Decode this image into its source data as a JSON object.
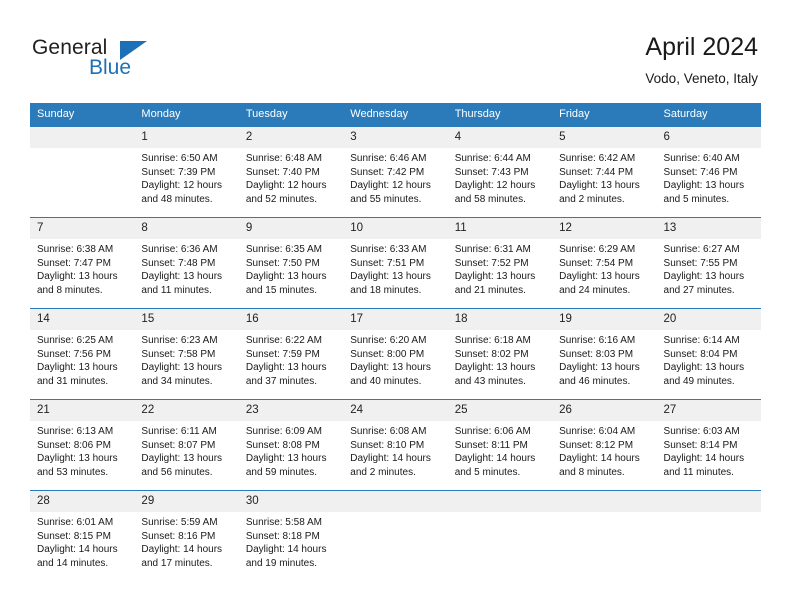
{
  "logo": {
    "text_primary": "General",
    "text_secondary": "Blue",
    "triangle_color": "#1d70b8",
    "primary_color": "#231f20"
  },
  "header": {
    "title": "April 2024",
    "subtitle": "Vodo, Veneto, Italy"
  },
  "theme": {
    "header_row_bg": "#2b7bba",
    "header_row_text": "#ffffff",
    "daynum_bg": "#f0f0f0",
    "row_rule": "#2b7bba"
  },
  "weekday_headers": [
    "Sunday",
    "Monday",
    "Tuesday",
    "Wednesday",
    "Thursday",
    "Friday",
    "Saturday"
  ],
  "weeks": [
    [
      {
        "day": "",
        "empty": true,
        "sunrise": "",
        "sunset": "",
        "daylight_line1": "",
        "daylight_line2": ""
      },
      {
        "day": "1",
        "empty": false,
        "sunrise": "Sunrise: 6:50 AM",
        "sunset": "Sunset: 7:39 PM",
        "daylight_line1": "Daylight: 12 hours",
        "daylight_line2": "and 48 minutes."
      },
      {
        "day": "2",
        "empty": false,
        "sunrise": "Sunrise: 6:48 AM",
        "sunset": "Sunset: 7:40 PM",
        "daylight_line1": "Daylight: 12 hours",
        "daylight_line2": "and 52 minutes."
      },
      {
        "day": "3",
        "empty": false,
        "sunrise": "Sunrise: 6:46 AM",
        "sunset": "Sunset: 7:42 PM",
        "daylight_line1": "Daylight: 12 hours",
        "daylight_line2": "and 55 minutes."
      },
      {
        "day": "4",
        "empty": false,
        "sunrise": "Sunrise: 6:44 AM",
        "sunset": "Sunset: 7:43 PM",
        "daylight_line1": "Daylight: 12 hours",
        "daylight_line2": "and 58 minutes."
      },
      {
        "day": "5",
        "empty": false,
        "sunrise": "Sunrise: 6:42 AM",
        "sunset": "Sunset: 7:44 PM",
        "daylight_line1": "Daylight: 13 hours",
        "daylight_line2": "and 2 minutes."
      },
      {
        "day": "6",
        "empty": false,
        "sunrise": "Sunrise: 6:40 AM",
        "sunset": "Sunset: 7:46 PM",
        "daylight_line1": "Daylight: 13 hours",
        "daylight_line2": "and 5 minutes."
      }
    ],
    [
      {
        "day": "7",
        "empty": false,
        "sunrise": "Sunrise: 6:38 AM",
        "sunset": "Sunset: 7:47 PM",
        "daylight_line1": "Daylight: 13 hours",
        "daylight_line2": "and 8 minutes."
      },
      {
        "day": "8",
        "empty": false,
        "sunrise": "Sunrise: 6:36 AM",
        "sunset": "Sunset: 7:48 PM",
        "daylight_line1": "Daylight: 13 hours",
        "daylight_line2": "and 11 minutes."
      },
      {
        "day": "9",
        "empty": false,
        "sunrise": "Sunrise: 6:35 AM",
        "sunset": "Sunset: 7:50 PM",
        "daylight_line1": "Daylight: 13 hours",
        "daylight_line2": "and 15 minutes."
      },
      {
        "day": "10",
        "empty": false,
        "sunrise": "Sunrise: 6:33 AM",
        "sunset": "Sunset: 7:51 PM",
        "daylight_line1": "Daylight: 13 hours",
        "daylight_line2": "and 18 minutes."
      },
      {
        "day": "11",
        "empty": false,
        "sunrise": "Sunrise: 6:31 AM",
        "sunset": "Sunset: 7:52 PM",
        "daylight_line1": "Daylight: 13 hours",
        "daylight_line2": "and 21 minutes."
      },
      {
        "day": "12",
        "empty": false,
        "sunrise": "Sunrise: 6:29 AM",
        "sunset": "Sunset: 7:54 PM",
        "daylight_line1": "Daylight: 13 hours",
        "daylight_line2": "and 24 minutes."
      },
      {
        "day": "13",
        "empty": false,
        "sunrise": "Sunrise: 6:27 AM",
        "sunset": "Sunset: 7:55 PM",
        "daylight_line1": "Daylight: 13 hours",
        "daylight_line2": "and 27 minutes."
      }
    ],
    [
      {
        "day": "14",
        "empty": false,
        "sunrise": "Sunrise: 6:25 AM",
        "sunset": "Sunset: 7:56 PM",
        "daylight_line1": "Daylight: 13 hours",
        "daylight_line2": "and 31 minutes."
      },
      {
        "day": "15",
        "empty": false,
        "sunrise": "Sunrise: 6:23 AM",
        "sunset": "Sunset: 7:58 PM",
        "daylight_line1": "Daylight: 13 hours",
        "daylight_line2": "and 34 minutes."
      },
      {
        "day": "16",
        "empty": false,
        "sunrise": "Sunrise: 6:22 AM",
        "sunset": "Sunset: 7:59 PM",
        "daylight_line1": "Daylight: 13 hours",
        "daylight_line2": "and 37 minutes."
      },
      {
        "day": "17",
        "empty": false,
        "sunrise": "Sunrise: 6:20 AM",
        "sunset": "Sunset: 8:00 PM",
        "daylight_line1": "Daylight: 13 hours",
        "daylight_line2": "and 40 minutes."
      },
      {
        "day": "18",
        "empty": false,
        "sunrise": "Sunrise: 6:18 AM",
        "sunset": "Sunset: 8:02 PM",
        "daylight_line1": "Daylight: 13 hours",
        "daylight_line2": "and 43 minutes."
      },
      {
        "day": "19",
        "empty": false,
        "sunrise": "Sunrise: 6:16 AM",
        "sunset": "Sunset: 8:03 PM",
        "daylight_line1": "Daylight: 13 hours",
        "daylight_line2": "and 46 minutes."
      },
      {
        "day": "20",
        "empty": false,
        "sunrise": "Sunrise: 6:14 AM",
        "sunset": "Sunset: 8:04 PM",
        "daylight_line1": "Daylight: 13 hours",
        "daylight_line2": "and 49 minutes."
      }
    ],
    [
      {
        "day": "21",
        "empty": false,
        "sunrise": "Sunrise: 6:13 AM",
        "sunset": "Sunset: 8:06 PM",
        "daylight_line1": "Daylight: 13 hours",
        "daylight_line2": "and 53 minutes."
      },
      {
        "day": "22",
        "empty": false,
        "sunrise": "Sunrise: 6:11 AM",
        "sunset": "Sunset: 8:07 PM",
        "daylight_line1": "Daylight: 13 hours",
        "daylight_line2": "and 56 minutes."
      },
      {
        "day": "23",
        "empty": false,
        "sunrise": "Sunrise: 6:09 AM",
        "sunset": "Sunset: 8:08 PM",
        "daylight_line1": "Daylight: 13 hours",
        "daylight_line2": "and 59 minutes."
      },
      {
        "day": "24",
        "empty": false,
        "sunrise": "Sunrise: 6:08 AM",
        "sunset": "Sunset: 8:10 PM",
        "daylight_line1": "Daylight: 14 hours",
        "daylight_line2": "and 2 minutes."
      },
      {
        "day": "25",
        "empty": false,
        "sunrise": "Sunrise: 6:06 AM",
        "sunset": "Sunset: 8:11 PM",
        "daylight_line1": "Daylight: 14 hours",
        "daylight_line2": "and 5 minutes."
      },
      {
        "day": "26",
        "empty": false,
        "sunrise": "Sunrise: 6:04 AM",
        "sunset": "Sunset: 8:12 PM",
        "daylight_line1": "Daylight: 14 hours",
        "daylight_line2": "and 8 minutes."
      },
      {
        "day": "27",
        "empty": false,
        "sunrise": "Sunrise: 6:03 AM",
        "sunset": "Sunset: 8:14 PM",
        "daylight_line1": "Daylight: 14 hours",
        "daylight_line2": "and 11 minutes."
      }
    ],
    [
      {
        "day": "28",
        "empty": false,
        "sunrise": "Sunrise: 6:01 AM",
        "sunset": "Sunset: 8:15 PM",
        "daylight_line1": "Daylight: 14 hours",
        "daylight_line2": "and 14 minutes."
      },
      {
        "day": "29",
        "empty": false,
        "sunrise": "Sunrise: 5:59 AM",
        "sunset": "Sunset: 8:16 PM",
        "daylight_line1": "Daylight: 14 hours",
        "daylight_line2": "and 17 minutes."
      },
      {
        "day": "30",
        "empty": false,
        "sunrise": "Sunrise: 5:58 AM",
        "sunset": "Sunset: 8:18 PM",
        "daylight_line1": "Daylight: 14 hours",
        "daylight_line2": "and 19 minutes."
      },
      {
        "day": "",
        "empty": true,
        "sunrise": "",
        "sunset": "",
        "daylight_line1": "",
        "daylight_line2": ""
      },
      {
        "day": "",
        "empty": true,
        "sunrise": "",
        "sunset": "",
        "daylight_line1": "",
        "daylight_line2": ""
      },
      {
        "day": "",
        "empty": true,
        "sunrise": "",
        "sunset": "",
        "daylight_line1": "",
        "daylight_line2": ""
      },
      {
        "day": "",
        "empty": true,
        "sunrise": "",
        "sunset": "",
        "daylight_line1": "",
        "daylight_line2": ""
      }
    ]
  ]
}
